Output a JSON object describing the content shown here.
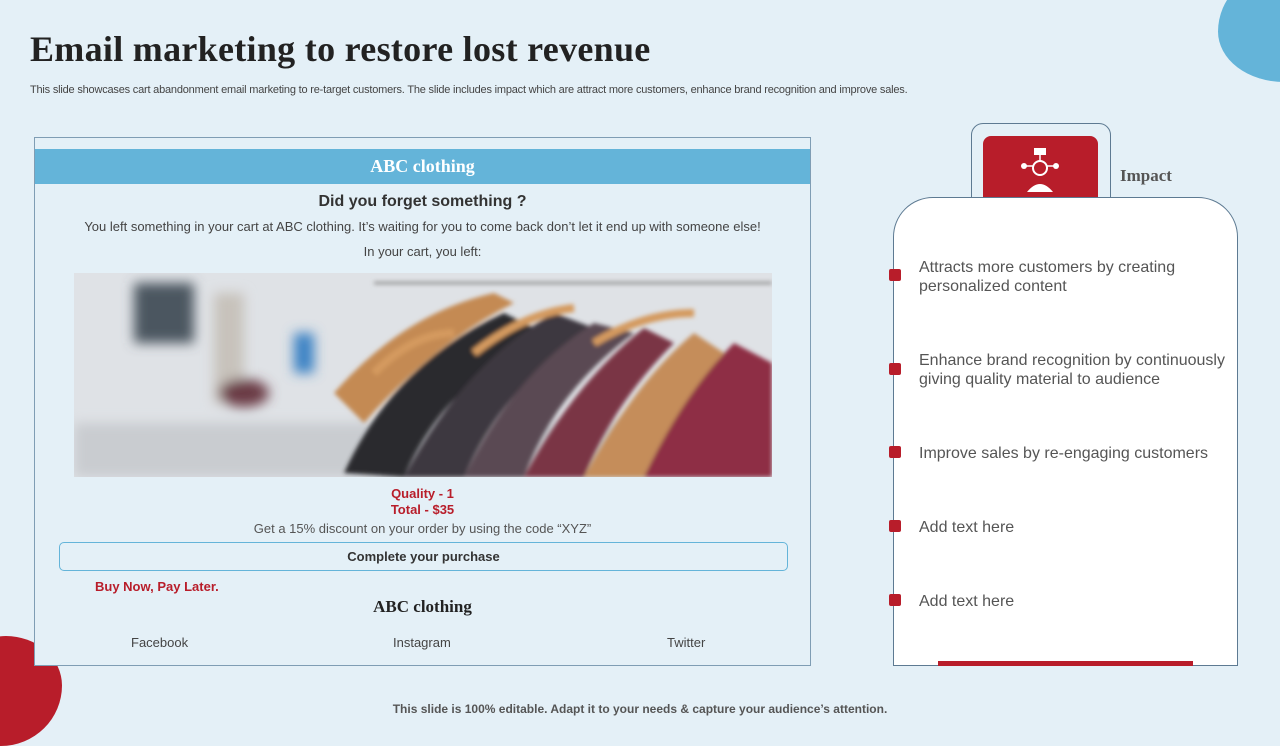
{
  "slide": {
    "title": "Email marketing to restore lost revenue",
    "subtitle": "This slide showcases cart abandonment email marketing to re-target customers. The slide includes impact which are attract more customers, enhance brand recognition and improve sales.",
    "footer": "This slide is 100% editable. Adapt it to your needs & capture your audience’s attention."
  },
  "email": {
    "brand": "ABC clothing",
    "question": "Did you forget something ?",
    "message": "You left something in your cart at ABC clothing. It’s waiting for you to come back don’t let it end up with someone else!",
    "cart_label": "In your cart, you left:",
    "quantity": "Quality - 1",
    "total": "Total - $35",
    "discount": "Get a 15% discount on your order by using the  code “XYZ”",
    "cta": "Complete your purchase",
    "bnpl": "Buy Now, Pay Later.",
    "footer_brand": "ABC clothing",
    "social": [
      "Facebook",
      "Instagram",
      "Twitter"
    ]
  },
  "impact": {
    "label": "Impact",
    "items": [
      "Attracts more customers by creating personalized content",
      "Enhance brand recognition by continuously giving quality material to audience",
      "Improve sales by re-engaging customers",
      "Add text here",
      "Add text here"
    ]
  },
  "colors": {
    "accent_red": "#b81d2a",
    "accent_blue": "#64b4d9",
    "background": "#e4f0f7"
  },
  "icons": {
    "impact": "person-network-icon"
  }
}
